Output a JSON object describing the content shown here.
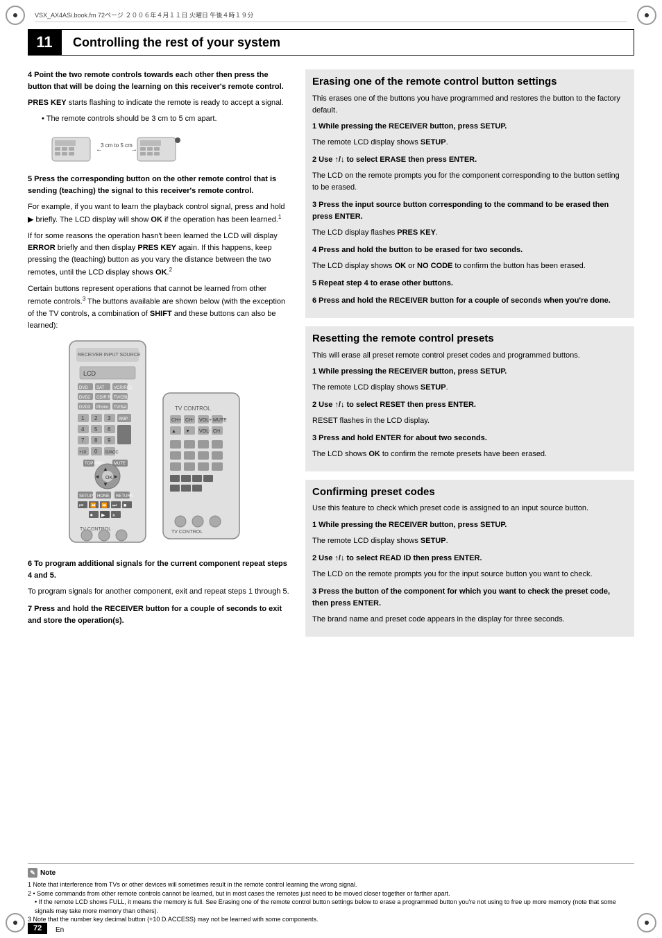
{
  "page": {
    "header_text": "VSX_AX4ASi.book.fm  72ページ  ２００６年４月１１日  火曜日  午後４時１９分",
    "chapter_number": "11",
    "chapter_title": "Controlling the rest of your system",
    "page_number": "72",
    "page_lang": "En"
  },
  "left_col": {
    "step4_title": "4   Point the two remote controls towards each other then press the button that will be doing the learning on this receiver's remote control.",
    "step4_body1": "PRES KEY starts flashing to indicate the remote is ready to accept a signal.",
    "step4_bullet1": "The remote controls should be 3 cm to 5 cm apart.",
    "diagram_label": "3 cm to 5 cm",
    "step5_title": "5   Press the corresponding button on the other remote control that is sending (teaching) the signal to this receiver's remote control.",
    "step5_body1": "For example, if you want to learn the playback control signal, press and hold ▶ briefly. The LCD display will show OK if the operation has been learned.",
    "step5_note1": "If for some reasons the operation hasn't been learned the LCD will display ERROR briefly and then display PRES KEY again. If this happens, keep pressing the (teaching) button as you vary the distance between the two remotes, until the LCD display shows OK.",
    "step5_note2": "Certain buttons represent operations that cannot be learned from other remote controls.",
    "step5_note2b": " The buttons available are shown below (with the exception of the TV controls, a combination of SHIFT and these buttons can also be learned):",
    "step6_title": "6   To program additional signals for the current component repeat steps 4 and 5.",
    "step6_body": "To program signals for another component, exit and repeat steps 1 through 5.",
    "step7_title": "7   Press and hold the RECEIVER button for a couple of seconds to exit and store the operation(s)."
  },
  "right_col": {
    "section1_title": "Erasing one of the remote control button settings",
    "section1_intro": "This erases one of the buttons you have programmed and restores the button to the factory default.",
    "s1_step1_title": "1   While pressing the RECEIVER button, press SETUP.",
    "s1_step1_body": "The remote LCD display shows SETUP.",
    "s1_step2_title": "2   Use ↑/↓ to select ERASE then press ENTER.",
    "s1_step2_body": "The LCD on the remote prompts you for the component corresponding to the button setting to be erased.",
    "s1_step3_title": "3   Press the input source button corresponding to the command to be erased then press ENTER.",
    "s1_step3_body": "The LCD display flashes PRES KEY.",
    "s1_step4_title": "4   Press and hold the button to be erased for two seconds.",
    "s1_step4_body": "The LCD display shows OK or NO CODE to confirm the button has been erased.",
    "s1_step5_title": "5   Repeat step 4 to erase other buttons.",
    "s1_step6_title": "6   Press and hold the RECEIVER button for a couple of seconds when you're done.",
    "section2_title": "Resetting the remote control presets",
    "section2_intro": "This will erase all preset remote control preset codes and programmed buttons.",
    "s2_step1_title": "1   While pressing the RECEIVER button, press SETUP.",
    "s2_step1_body": "The remote LCD display shows SETUP.",
    "s2_step2_title": "2   Use ↑/↓ to select RESET then press ENTER.",
    "s2_step2_body": "RESET flashes in the LCD display.",
    "s2_step3_title": "3   Press and hold ENTER for about two seconds.",
    "s2_step3_body": "The LCD shows OK to confirm the remote presets have been erased.",
    "section3_title": "Confirming preset codes",
    "section3_intro": "Use this feature to check which preset code is assigned to an input source button.",
    "s3_step1_title": "1   While pressing the RECEIVER button, press SETUP.",
    "s3_step1_body": "The remote LCD display shows SETUP.",
    "s3_step2_title": "2   Use ↑/↓ to select READ ID then press ENTER.",
    "s3_step2_body": "The LCD on the remote prompts you for the input source button you want to check.",
    "s3_step3_title": "3   Press the button of the component for which you want to check the preset code, then press ENTER.",
    "s3_step3_body": "The brand name and preset code appears in the display for three seconds."
  },
  "notes": {
    "title": "Note",
    "note1": "1  Note that interference from TVs or other devices will sometimes result in the remote control learning the wrong signal.",
    "note2": "2  • Some commands from other remote controls cannot be learned, but in most cases the remotes just need to be moved closer together or farther apart.",
    "note2b": "   • If the remote LCD shows FULL, it means the memory is full. See Erasing one of the remote control button settings below to erase a programmed button you're not using to free up more memory (note that some signals may take more memory than others).",
    "note3": "3  Note that the number key decimal button (+10 D.ACCESS) may not be learned with some components."
  }
}
